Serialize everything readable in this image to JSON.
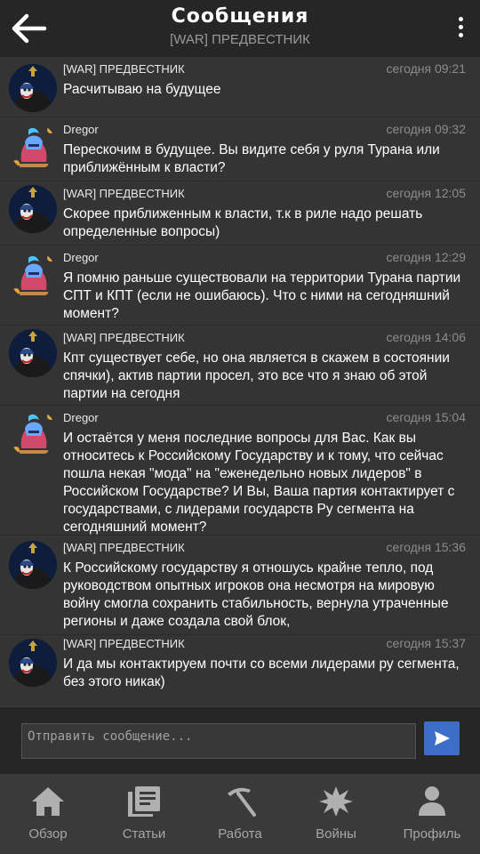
{
  "header": {
    "title": "Сообщения",
    "subtitle": "[WAR] ПРЕДВЕСТНИК",
    "back_icon": "arrow-left-icon",
    "menu_icon": "more-vertical-icon"
  },
  "messages": [
    {
      "author": "[WAR] ПРЕДВЕСТНИК",
      "time": "сегодня 09:21",
      "text": "Расчитываю на будущее",
      "avatar": "joker-avatar"
    },
    {
      "author": "Dregor",
      "time": "сегодня 09:32",
      "text": "Перескочим в будущее. Вы видите себя у руля Турана или приближённым к власти?",
      "avatar": "knight-avatar"
    },
    {
      "author": "[WAR] ПРЕДВЕСТНИК",
      "time": "сегодня 12:05",
      "text": "Скорее приближенным к власти, т.к в риле надо решать определенные вопросы)",
      "avatar": "joker-avatar"
    },
    {
      "author": "Dregor",
      "time": "сегодня 12:29",
      "text": "Я помню раньше существовали на территории Турана партии СПТ и КПТ (если не ошибаюсь). Что с ними на сегодняшний момент?",
      "avatar": "knight-avatar"
    },
    {
      "author": "[WAR] ПРЕДВЕСТНИК",
      "time": "сегодня 14:06",
      "text": "Кпт существует себе, но она является в скажем в состоянии спячки), актив партии просел, это все что я знаю об этой партии на сегодня",
      "avatar": "joker-avatar"
    },
    {
      "author": "Dregor",
      "time": "сегодня 15:04",
      "text": "И остаётся у меня последние вопросы для Вас. Как вы относитесь к Российскому Государству и к тому, что сейчас пошла некая \"мода\" на \"еженедельно новых лидеров\" в Российском Государстве? И Вы, Ваша партия контактирует с государствами, с лидерами государств Ру сегмента на сегодняшний момент?",
      "avatar": "knight-avatar"
    },
    {
      "author": "[WAR] ПРЕДВЕСТНИК",
      "time": "сегодня 15:36",
      "text": "К Российскому государству я отношусь крайне тепло, под руководством опытных игроков она несмотря на мировую войну смогла сохранить стабильность, вернула утраченные регионы и даже создала свой блок,",
      "avatar": "joker-avatar"
    },
    {
      "author": "[WAR] ПРЕДВЕСТНИК",
      "time": "сегодня 15:37",
      "text": "И да мы контактируем почти со всеми лидерами ру сегмента, без этого никак)",
      "avatar": "joker-avatar"
    }
  ],
  "composer": {
    "placeholder": "Отправить сообщение...",
    "value": "",
    "send_icon": "send-icon",
    "accent": "#3d6fc9"
  },
  "tabs": [
    {
      "label": "Обзор",
      "icon": "home-icon"
    },
    {
      "label": "Статьи",
      "icon": "articles-icon"
    },
    {
      "label": "Работа",
      "icon": "pickaxe-icon"
    },
    {
      "label": "Войны",
      "icon": "explosion-icon"
    },
    {
      "label": "Профиль",
      "icon": "profile-icon"
    }
  ]
}
